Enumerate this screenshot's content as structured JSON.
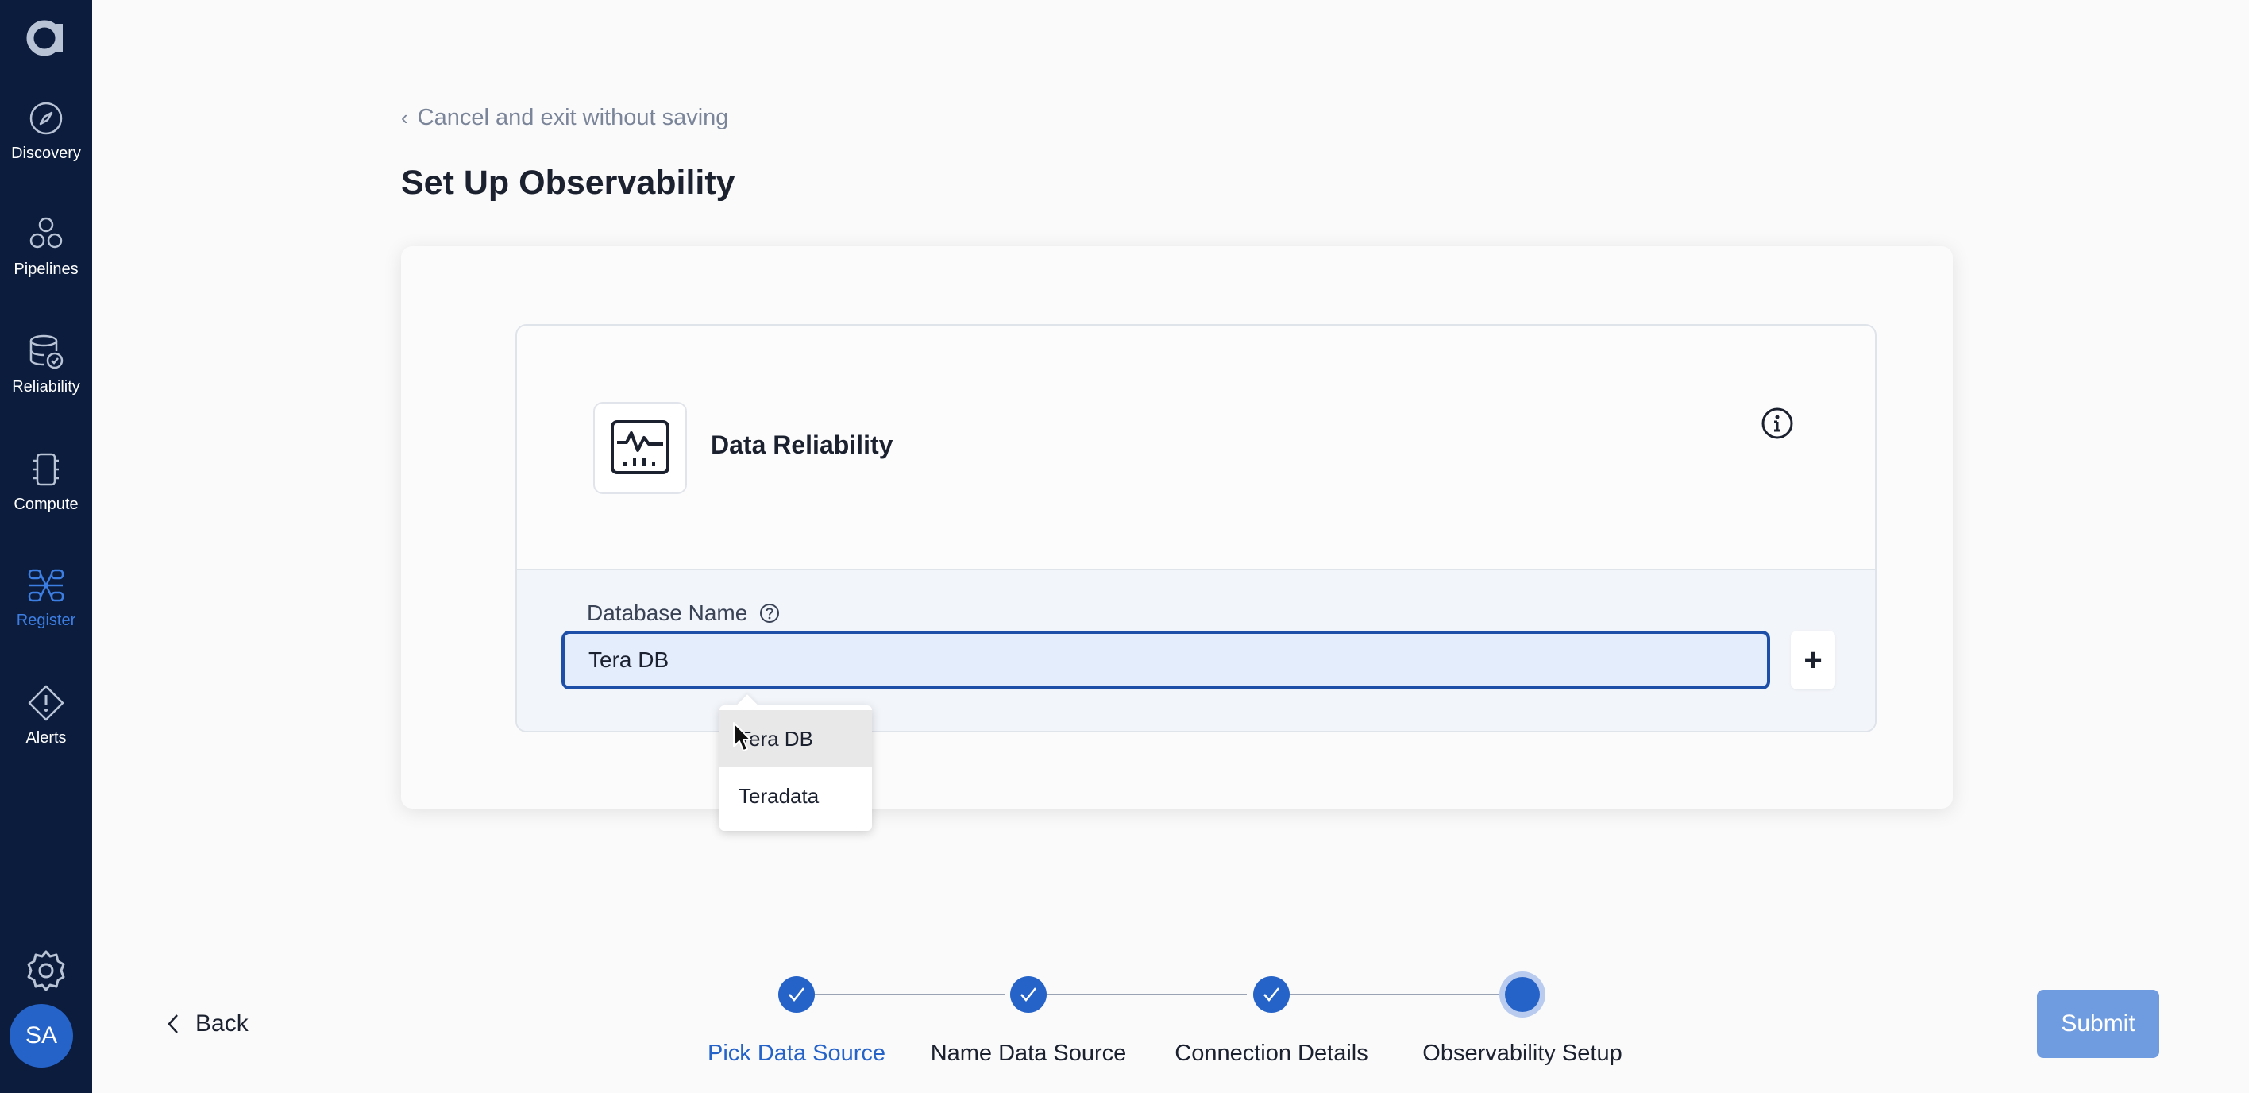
{
  "sidebar": {
    "items": [
      {
        "label": "Discovery",
        "icon": "compass-icon"
      },
      {
        "label": "Pipelines",
        "icon": "pipelines-icon"
      },
      {
        "label": "Reliability",
        "icon": "database-check-icon"
      },
      {
        "label": "Compute",
        "icon": "chip-icon"
      },
      {
        "label": "Register",
        "icon": "register-icon",
        "active": true
      },
      {
        "label": "Alerts",
        "icon": "alert-diamond-icon"
      }
    ],
    "avatar_initials": "SA"
  },
  "header": {
    "cancel_label": "Cancel and exit without saving",
    "title": "Set Up Observability"
  },
  "card": {
    "title": "Data Reliability",
    "field_label": "Database Name",
    "field_value": "Tera DB",
    "add_label": "+"
  },
  "dropdown": {
    "options": [
      "Tera DB",
      "Teradata"
    ]
  },
  "stepper": {
    "steps": [
      "Pick Data Source",
      "Name Data Source",
      "Connection Details",
      "Observability Setup"
    ]
  },
  "footer": {
    "back_label": "Back",
    "submit_label": "Submit"
  },
  "colors": {
    "sidebar_bg": "#0b1c3d",
    "accent": "#2563c9",
    "submit_bg": "#6f9be0"
  }
}
